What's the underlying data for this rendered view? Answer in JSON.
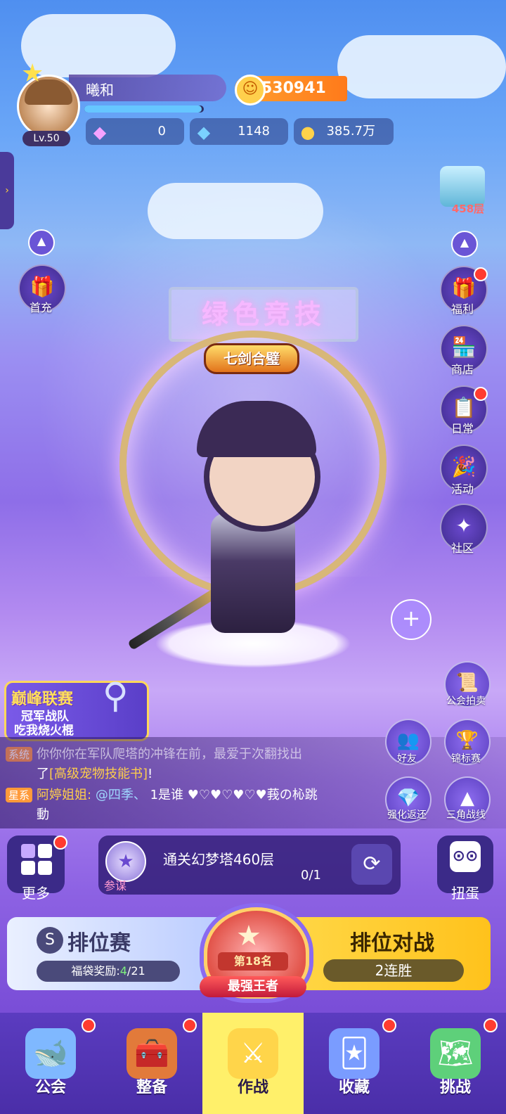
{
  "player": {
    "name": "曦和",
    "level": "Lv.50",
    "xp_fraction": 0.98,
    "score": "530941",
    "currencies": [
      {
        "icon": "pink-gem-icon",
        "value": "0"
      },
      {
        "icon": "blue-diamond-icon",
        "value": "1148"
      },
      {
        "icon": "gold-coin-icon",
        "value": "385.7万"
      }
    ]
  },
  "tower": {
    "label": "458层"
  },
  "left_buttons": {
    "first_charge": "首充"
  },
  "right_menu": [
    {
      "label": "福利",
      "icon": "gift-icon",
      "dot": true
    },
    {
      "label": "商店",
      "icon": "shop-icon",
      "dot": false
    },
    {
      "label": "日常",
      "icon": "daily-icon",
      "dot": true
    },
    {
      "label": "活动",
      "icon": "party-icon",
      "dot": false
    },
    {
      "label": "社区",
      "icon": "community-icon",
      "dot": false
    }
  ],
  "stage": {
    "sign": "绿色竞技",
    "skill_badge": "七剑合璧"
  },
  "banner": {
    "title": "巅峰联赛",
    "line1": "冠军战队",
    "line2": "吃我烧火棍"
  },
  "chat": {
    "line1_tag": "系统",
    "line1_text": "你你你在军队爬塔的冲锋在前，最爱于次翻找出",
    "line2_prefix": "了",
    "line2_highlight": "[高级宠物技能书]",
    "line2_suffix": "!",
    "line3_tag": "星系",
    "line3_name": "阿婷姐姐:",
    "line3_at": "@四季、",
    "line3_text": "1是谁 ♥♡♥♡♥♡♥莪の杺跳",
    "line4_text": "動"
  },
  "side_right": [
    {
      "label": "公会拍卖",
      "icon": "auction-icon"
    },
    {
      "label": "好友",
      "icon": "friends-icon"
    },
    {
      "label": "锦标赛",
      "icon": "trophy-icon"
    },
    {
      "label": "强化返还",
      "icon": "crystal-icon"
    },
    {
      "label": "三角战线",
      "icon": "triangle-icon"
    }
  ],
  "quest": {
    "more_label": "更多",
    "tag": "参谋",
    "text": "通关幻梦塔460层",
    "progress": "0/1",
    "gacha_label": "扭蛋"
  },
  "rank": {
    "left_title": "排位赛",
    "reward_label": "福袋奖励:",
    "reward_value": "4",
    "reward_total": "/21",
    "right_title": "排位对战",
    "streak": "2连胜",
    "rank_number": "第18名",
    "rank_title": "最强王者"
  },
  "nav": [
    {
      "label": "公会",
      "icon": "guild-whale-icon",
      "dot": true,
      "active": false
    },
    {
      "label": "整备",
      "icon": "equipment-chest-icon",
      "dot": true,
      "active": false
    },
    {
      "label": "作战",
      "icon": "crossed-swords-icon",
      "dot": false,
      "active": true
    },
    {
      "label": "收藏",
      "icon": "collection-cards-icon",
      "dot": true,
      "active": false
    },
    {
      "label": "挑战",
      "icon": "challenge-map-icon",
      "dot": true,
      "active": false
    }
  ]
}
